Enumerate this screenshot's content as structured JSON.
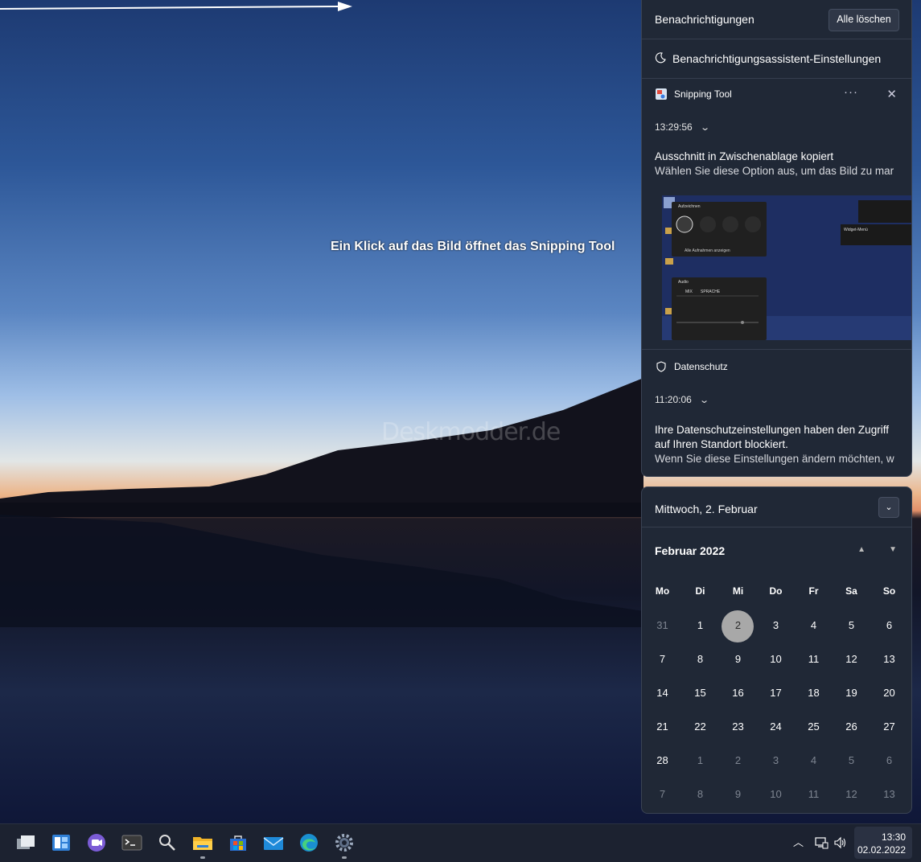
{
  "wallpaper": {
    "watermark": "Deskmodder.de",
    "annotation": "Ein Klick auf das Bild öffnet das Snipping Tool"
  },
  "notifications": {
    "title": "Benachrichtigungen",
    "clear_all": "Alle löschen",
    "focus_assist": "Benachrichtigungsassistent-Einstellungen",
    "items": [
      {
        "app": "Snipping Tool",
        "time": "13:29:56",
        "heading": "Ausschnitt in Zwischenablage kopiert",
        "body": "Wählen Sie diese Option aus, um das Bild zu mar"
      },
      {
        "app": "Datenschutz",
        "time": "11:20:06",
        "heading": "Ihre Datenschutzeinstellungen haben den Zugriff",
        "heading2": "auf Ihren Standort blockiert.",
        "body": "Wenn Sie diese Einstellungen ändern möchten, w"
      }
    ],
    "preview": {
      "panel1_title": "Aufzeichnen",
      "panel1_link": "Alle Aufnahmen anzeigen",
      "panel2_title": "Audio",
      "panel2_tab1": "MIX",
      "panel2_tab2": "SPRACHE",
      "widget_title": "Widget-Menü"
    }
  },
  "calendar": {
    "date_header": "Mittwoch, 2. Februar",
    "month": "Februar 2022",
    "weekdays": [
      "Mo",
      "Di",
      "Mi",
      "Do",
      "Fr",
      "Sa",
      "So"
    ],
    "days": [
      [
        "31",
        "1",
        "2",
        "3",
        "4",
        "5",
        "6"
      ],
      [
        "7",
        "8",
        "9",
        "10",
        "11",
        "12",
        "13"
      ],
      [
        "14",
        "15",
        "16",
        "17",
        "18",
        "19",
        "20"
      ],
      [
        "21",
        "22",
        "23",
        "24",
        "25",
        "26",
        "27"
      ],
      [
        "28",
        "1",
        "2",
        "3",
        "4",
        "5",
        "6"
      ],
      [
        "7",
        "8",
        "9",
        "10",
        "11",
        "12",
        "13"
      ]
    ],
    "today": "2"
  },
  "taskbar": {
    "icons": [
      "task-view-icon",
      "widgets-icon",
      "teams-chat-icon",
      "terminal-icon",
      "search-icon",
      "file-explorer-icon",
      "store-icon",
      "mail-icon",
      "edge-icon",
      "settings-icon"
    ],
    "time": "13:30",
    "date": "02.02.2022"
  },
  "colors": {
    "panel": "#202836",
    "taskbar": "#1c2230",
    "today": "#a8a8a8"
  }
}
